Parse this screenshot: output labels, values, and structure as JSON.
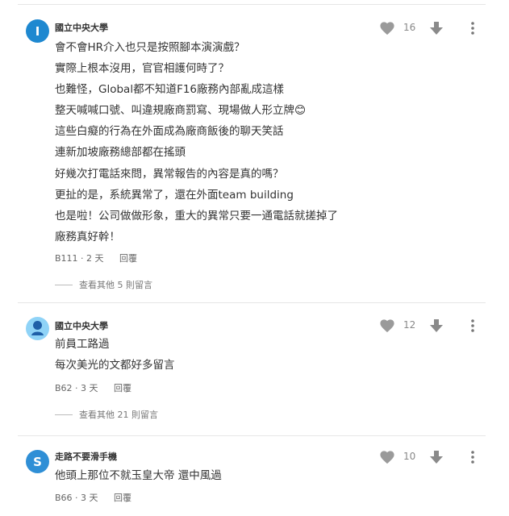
{
  "comments": [
    {
      "avatar_letter": "I",
      "avatar_color": "#1e88d0",
      "school": "國立中央大學",
      "likes": "16",
      "lines": [
        "會不會HR介入也只是按照腳本演演戲？",
        "實際上根本沒用，官官相護何時了？",
        "也難怪，Global都不知道F16廠務內部亂成這樣",
        "整天喊喊口號、叫違規廠商罰寫、現場做人形立牌😊",
        "這些白癡的行為在外面成為廠商飯後的聊天笑話",
        "連新加坡廠務總部都在搖頭",
        "好幾次打電話來問，異常報告的內容是真的嗎？",
        "更扯的是，系統異常了，還在外面team building",
        "也是啦！公司做做形象，重大的異常只要一通電話就搓掉了",
        "廠務真好幹！"
      ],
      "floor": "B111",
      "time": "2 天",
      "reply": "回覆",
      "more": "查看其他 5 則留言"
    },
    {
      "avatar_letter": "",
      "avatar_color": "#8fd3f7",
      "school": "國立中央大學",
      "likes": "12",
      "lines": [
        "前員工路過",
        "每次美光的文都好多留言"
      ],
      "floor": "B62",
      "time": "3 天",
      "reply": "回覆",
      "more": "查看其他 21 則留言"
    },
    {
      "avatar_letter": "S",
      "avatar_color": "#2f8fd6",
      "school": "走路不要滑手機",
      "likes": "10",
      "lines": [
        "他頭上那位不就玉皇大帝 還中風過"
      ],
      "floor": "B66",
      "time": "3 天",
      "reply": "回覆",
      "more": ""
    }
  ]
}
